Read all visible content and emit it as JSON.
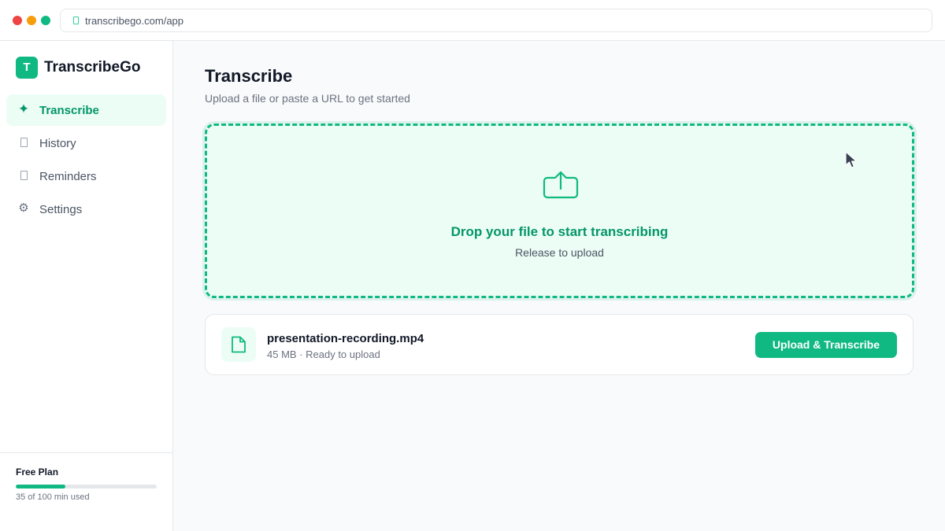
{
  "browser": {
    "url": "transcribego.com/app"
  },
  "sidebar": {
    "app_name": "TranscribeGo",
    "logo_letter": "T",
    "items": [
      {
        "label": "Transcribe",
        "icon": "sparkle-icon",
        "active": true
      },
      {
        "label": "History",
        "icon": "document-icon",
        "active": false
      },
      {
        "label": "Reminders",
        "icon": "bell-icon",
        "active": false
      },
      {
        "label": "Settings",
        "icon": "gear-icon",
        "active": false
      }
    ],
    "plan": {
      "title": "Free Plan",
      "usage_text": "35 of 100 min used",
      "used_fraction": 0.35
    }
  },
  "main": {
    "title": "Transcribe",
    "subtitle": "Upload a file or paste a URL to get started",
    "dropzone": {
      "title": "Drop your file to start transcribing",
      "subtitle": "Release to upload"
    },
    "file": {
      "name": "presentation-recording.mp4",
      "meta": "45 MB · Ready to upload",
      "button_label": "Upload & Transcribe"
    }
  },
  "colors": {
    "accent": "#10b981",
    "accent_dark": "#059669",
    "accent_light": "#ecfdf5"
  }
}
